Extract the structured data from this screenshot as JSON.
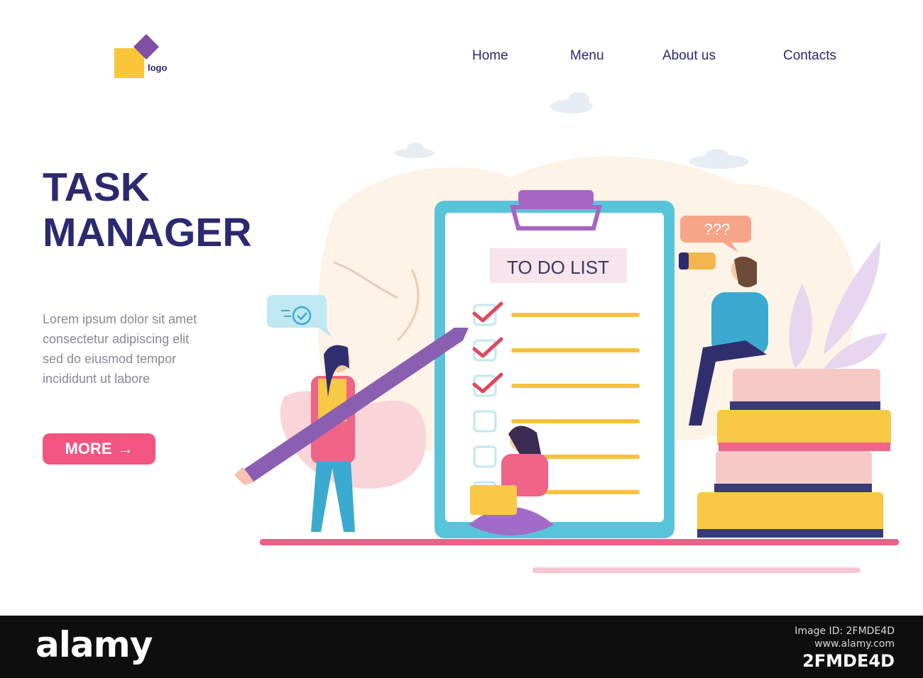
{
  "logo": {
    "text": "logo",
    "colors": [
      "#f9c63a",
      "#7e4fa3"
    ]
  },
  "nav": [
    {
      "label": "Home"
    },
    {
      "label": "Menu"
    },
    {
      "label": "About us"
    },
    {
      "label": "Contacts"
    }
  ],
  "hero": {
    "title_line1": "TASK",
    "title_line2": "MANAGER",
    "body_lines": [
      "Lorem ipsum dolor sit amet",
      "consectetur adipiscing elit",
      "sed do eiusmod tempor",
      "incididunt ut labore"
    ],
    "button_label": "MORE",
    "button_icon": "arrow-right-icon"
  },
  "illustration": {
    "clipboard_title": "TO DO LIST",
    "speech_bubble": "???",
    "bubble_icon": "stopwatch-check-icon",
    "checklist": [
      {
        "checked": true
      },
      {
        "checked": true
      },
      {
        "checked": true
      },
      {
        "checked": false
      },
      {
        "checked": false
      },
      {
        "checked": false
      }
    ]
  },
  "footer": {
    "brand": "alamy",
    "line1": "Image ID: 2FMDE4D",
    "line2": "www.alamy.com",
    "image_id": "2FMDE4D"
  },
  "colors": {
    "primary_text": "#2b2970",
    "accent": "#f2557f",
    "muted_text": "#8a8898",
    "clipboard_border": "#58c4d9",
    "check": "#e0475f",
    "list_line": "#f6c23e"
  }
}
